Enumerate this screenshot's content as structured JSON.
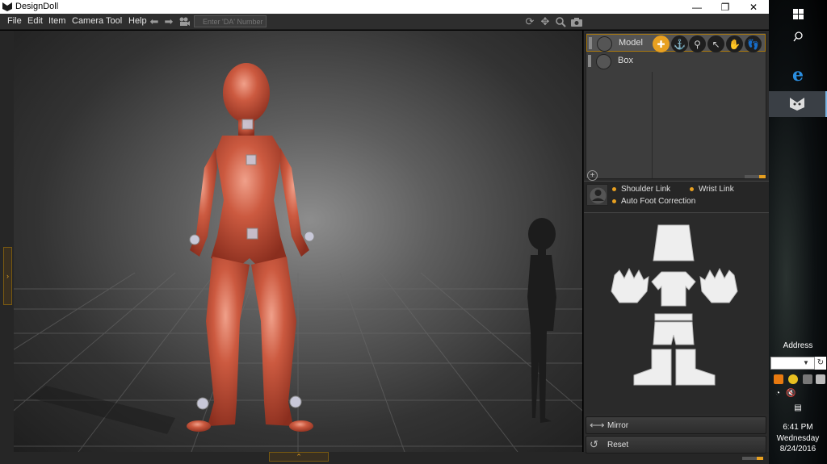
{
  "app": {
    "title": "DesignDoll"
  },
  "menu": {
    "items": [
      "File",
      "Edit",
      "Item",
      "Camera",
      "Tool",
      "Help"
    ]
  },
  "toolbar": {
    "da_placeholder": "Enter 'DA' Number"
  },
  "scene": {
    "items": [
      {
        "label": "Model",
        "selected": true
      },
      {
        "label": "Box",
        "selected": false
      }
    ]
  },
  "options": {
    "shoulder_link": "Shoulder Link",
    "wrist_link": "Wrist Link",
    "auto_foot": "Auto Foot Correction"
  },
  "actions": {
    "mirror": "Mirror",
    "reset": "Reset"
  },
  "taskbar": {
    "address_label": "Address",
    "time": "6:41 PM",
    "day": "Wednesday",
    "date": "8/24/2016"
  },
  "colors": {
    "accent": "#e8a020",
    "doll": "#c4563e",
    "panel": "#2b2b2b"
  },
  "icons": [
    "windows-start-icon",
    "search-icon",
    "edge-icon",
    "designdoll-icon",
    "undo-arrow-icon",
    "redo-arrow-icon",
    "camera-icon",
    "rotate-icon",
    "move-icon",
    "zoom-icon",
    "snapshot-icon"
  ]
}
